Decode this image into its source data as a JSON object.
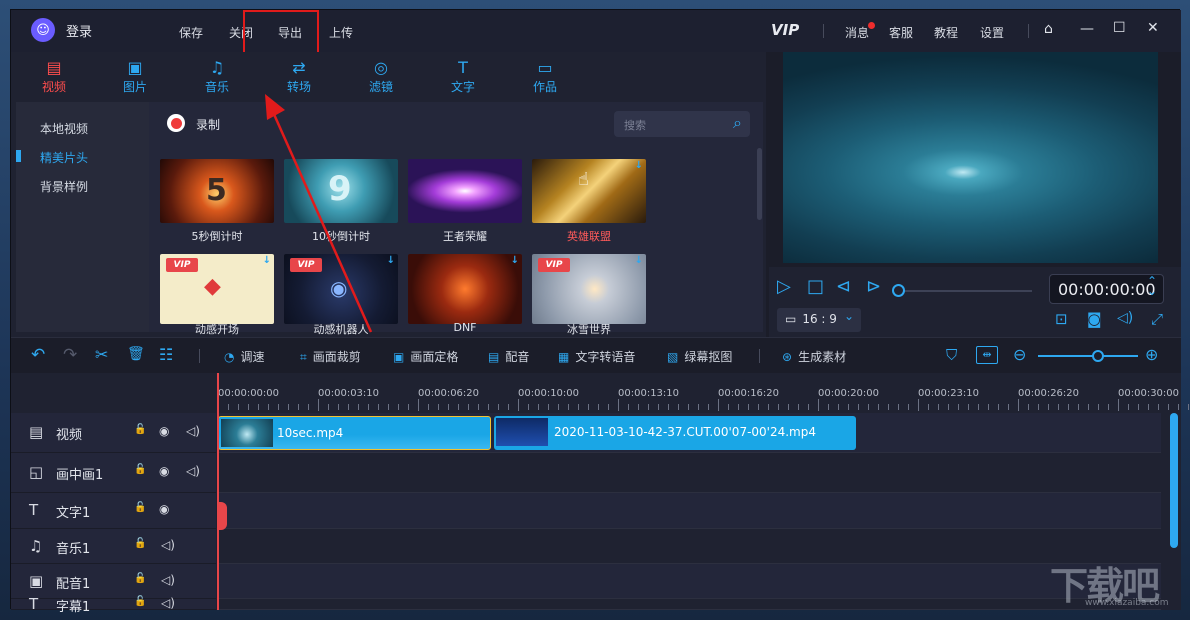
{
  "header": {
    "logo_glyph": "☺",
    "login_label": "登录",
    "menu": [
      "保存",
      "关闭",
      "导出",
      "上传"
    ],
    "highlight_item": "导出",
    "vip_label": "VIP",
    "right_links": [
      "消息",
      "客服",
      "教程",
      "设置"
    ],
    "home_icon": "⌂",
    "min_icon": "—",
    "max_icon": "☐",
    "close_icon": "✕"
  },
  "tabs": [
    {
      "label": "视频",
      "icon": "▤",
      "active": true
    },
    {
      "label": "图片",
      "icon": "▣"
    },
    {
      "label": "音乐",
      "icon": "♫"
    },
    {
      "label": "转场",
      "icon": "⇄"
    },
    {
      "label": "滤镜",
      "icon": "◎"
    },
    {
      "label": "文字",
      "icon": "T"
    },
    {
      "label": "作品",
      "icon": "▭"
    }
  ],
  "sidebar": {
    "items": [
      "本地视频",
      "精美片头",
      "背景样例"
    ],
    "active_index": 1
  },
  "content": {
    "record_label": "录制",
    "search_placeholder": "搜索",
    "search_icon": "⌕",
    "vip_badge": "VIP",
    "download_icon": "↓",
    "items": [
      {
        "label": "5秒倒计时",
        "glyph": "5",
        "vip": false,
        "download": false
      },
      {
        "label": "10秒倒计时",
        "glyph": "9",
        "vip": false,
        "download": false
      },
      {
        "label": "王者荣耀",
        "glyph": "",
        "vip": false,
        "download": false
      },
      {
        "label": "英雄联盟",
        "glyph": "",
        "vip": false,
        "download": true,
        "highlight": true
      },
      {
        "label": "动感开场",
        "glyph": "◆",
        "vip": true,
        "download": true
      },
      {
        "label": "动感机器人",
        "glyph": "◉",
        "vip": true,
        "download": true
      },
      {
        "label": "DNF",
        "glyph": "",
        "vip": false,
        "download": true
      },
      {
        "label": "冰雪世界",
        "glyph": "",
        "vip": true,
        "download": true
      }
    ]
  },
  "preview": {
    "timecode": "00:00:00:00",
    "ratio": "16 : 9",
    "play_icon": "▷",
    "stop_icon": "□",
    "prev_icon": "⊲",
    "next_icon": "⊳",
    "spin_up": "⌃",
    "spin_down": "⌄",
    "screen_icon": "▭",
    "chevron_icon": "⌄",
    "right_icons": [
      "⊡",
      "◙",
      "◁)",
      "⤢"
    ]
  },
  "toolbar": {
    "undo_icon": "↶",
    "redo_icon": "↷",
    "cut_icon": "✂",
    "delete_icon": "🗑",
    "settings_icon": "☷",
    "items": [
      {
        "label": "调速",
        "icon": "◔"
      },
      {
        "label": "画面裁剪",
        "icon": "⌗"
      },
      {
        "label": "画面定格",
        "icon": "▣"
      },
      {
        "label": "配音",
        "icon": "▤"
      },
      {
        "label": "文字转语音",
        "icon": "▦"
      },
      {
        "label": "绿幕抠图",
        "icon": "▧"
      },
      {
        "label": "生成素材",
        "icon": "⊛"
      }
    ],
    "marker_icon": "⛉",
    "fit_icon": "⇹",
    "zoom_out_icon": "⊖",
    "zoom_in_icon": "⊕",
    "zoom_level": 0.6
  },
  "timeline": {
    "ticks": [
      "00:00:00:00",
      "00:00:03:10",
      "00:00:06:20",
      "00:00:10:00",
      "00:00:13:10",
      "00:00:16:20",
      "00:00:20:00",
      "00:00:23:10",
      "00:00:26:20",
      "00:00:30:00"
    ],
    "lock_icon": "🔓",
    "eye_icon": "◉",
    "audio_icon": "◁)",
    "tracks": [
      {
        "name": "视频",
        "icon": "▤",
        "eye": true,
        "audio": true
      },
      {
        "name": "画中画1",
        "icon": "◱",
        "eye": true,
        "audio": true
      },
      {
        "name": "文字1",
        "icon": "T",
        "eye": true,
        "audio": false
      },
      {
        "name": "音乐1",
        "icon": "♫",
        "eye": false,
        "audio": true
      },
      {
        "name": "配音1",
        "icon": "▣",
        "eye": false,
        "audio": true
      },
      {
        "name": "字幕1",
        "icon": "T",
        "eye": false,
        "audio": true
      }
    ],
    "clips": [
      {
        "name": "10sec.mp4"
      },
      {
        "name": "2020-11-03-10-42-37.CUT.00'07-00'24.mp4"
      }
    ]
  },
  "watermark": {
    "text": "下载吧",
    "sub": "www.xiazaiba.com"
  }
}
